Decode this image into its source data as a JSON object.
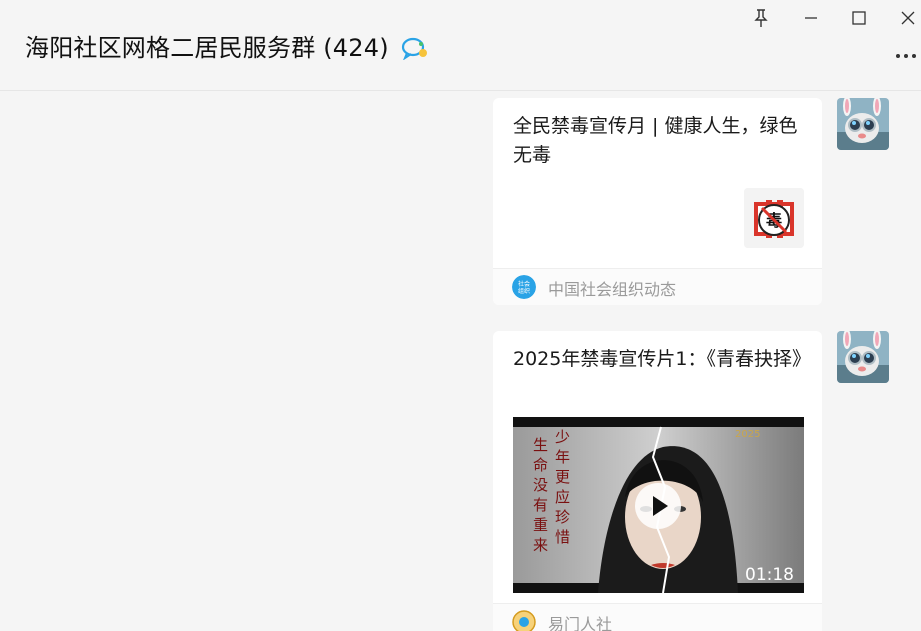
{
  "window": {
    "title": "海阳社区网格二居民服务群 (424)",
    "buttons": [
      "pin-icon",
      "minimize-icon",
      "maximize-icon",
      "close-icon",
      "more-icon"
    ]
  },
  "messages": [
    {
      "type": "article",
      "title": "全民禁毒宣传月 | 健康人生，绿色无毒",
      "thumbnail_text": "毒",
      "source": {
        "name": "中国社会组织动态",
        "icon": "社会组织"
      }
    },
    {
      "type": "video",
      "title": "2025年禁毒宣传片1：《青春抉择》",
      "video": {
        "left_poem": [
          "生命没有重来",
          "少年更应珍惜"
        ],
        "duration": "01:18",
        "corner_text": "2025"
      },
      "source": {
        "name": "易门人社"
      }
    }
  ],
  "colors": {
    "accent": "#2aa3e6",
    "badge_red": "#d9352b"
  }
}
